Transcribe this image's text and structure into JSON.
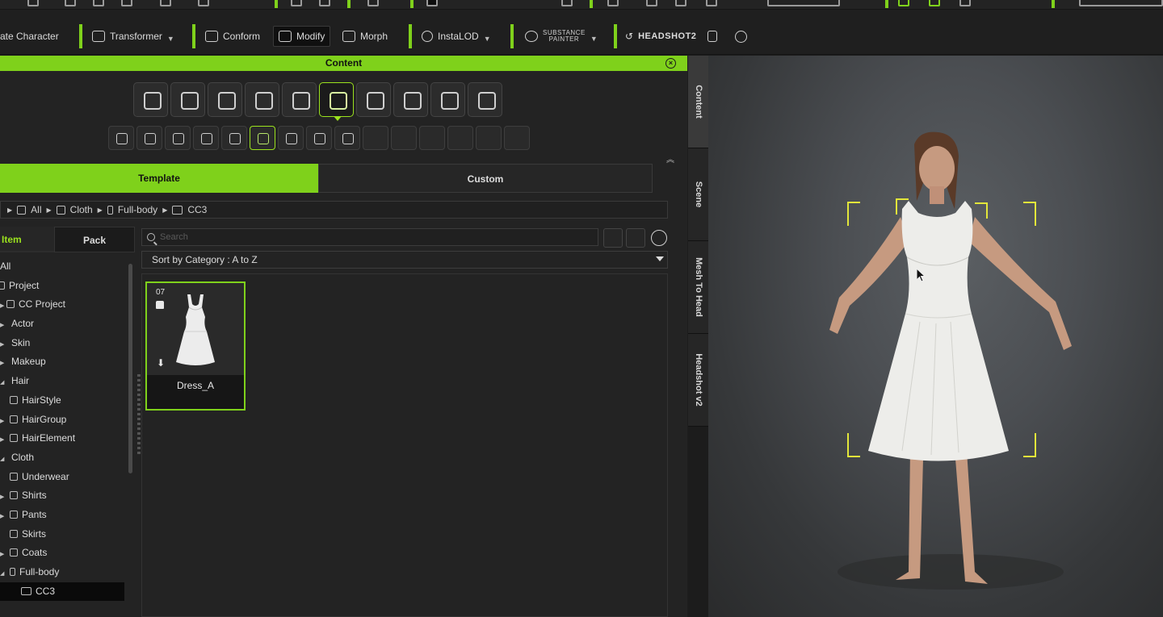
{
  "toolbar": {
    "items": [
      {
        "label": "ate Character"
      },
      {
        "label": "Transformer"
      },
      {
        "label": "Conform"
      },
      {
        "label": "Modify"
      },
      {
        "label": "Morph"
      },
      {
        "label": "InstaLOD"
      },
      {
        "label_top": "SUBSTANCE",
        "label_bottom": "PAINTER"
      },
      {
        "label": "HEADSHOT2"
      }
    ]
  },
  "panel": {
    "title": "Content",
    "tabs": [
      {
        "label": "Template"
      },
      {
        "label": "Custom"
      }
    ],
    "breadcrumb": [
      "All",
      "Cloth",
      "Full-body",
      "CC3"
    ],
    "item_tab": "Item",
    "pack_tab": "Pack",
    "search_placeholder": "Search",
    "sort_label": "Sort by Category : A to Z",
    "tree": [
      {
        "label": "All"
      },
      {
        "label": "Project"
      },
      {
        "label": "CC Project"
      },
      {
        "label": "Actor"
      },
      {
        "label": "Skin"
      },
      {
        "label": "Makeup"
      },
      {
        "label": "Hair"
      },
      {
        "label": "HairStyle"
      },
      {
        "label": "HairGroup"
      },
      {
        "label": "HairElement"
      },
      {
        "label": "Cloth"
      },
      {
        "label": "Underwear"
      },
      {
        "label": "Shirts"
      },
      {
        "label": "Pants"
      },
      {
        "label": "Skirts"
      },
      {
        "label": "Coats"
      },
      {
        "label": "Full-body"
      },
      {
        "label": "CC3"
      }
    ],
    "card": {
      "number": "07",
      "name": "Dress_A"
    }
  },
  "side_tabs": [
    {
      "label": "Content"
    },
    {
      "label": "Scene"
    },
    {
      "label": "Mesh To Head"
    },
    {
      "label": "Headshot v2"
    }
  ],
  "colors": {
    "accent": "#7fd11b",
    "bracket": "#e2e63a"
  }
}
